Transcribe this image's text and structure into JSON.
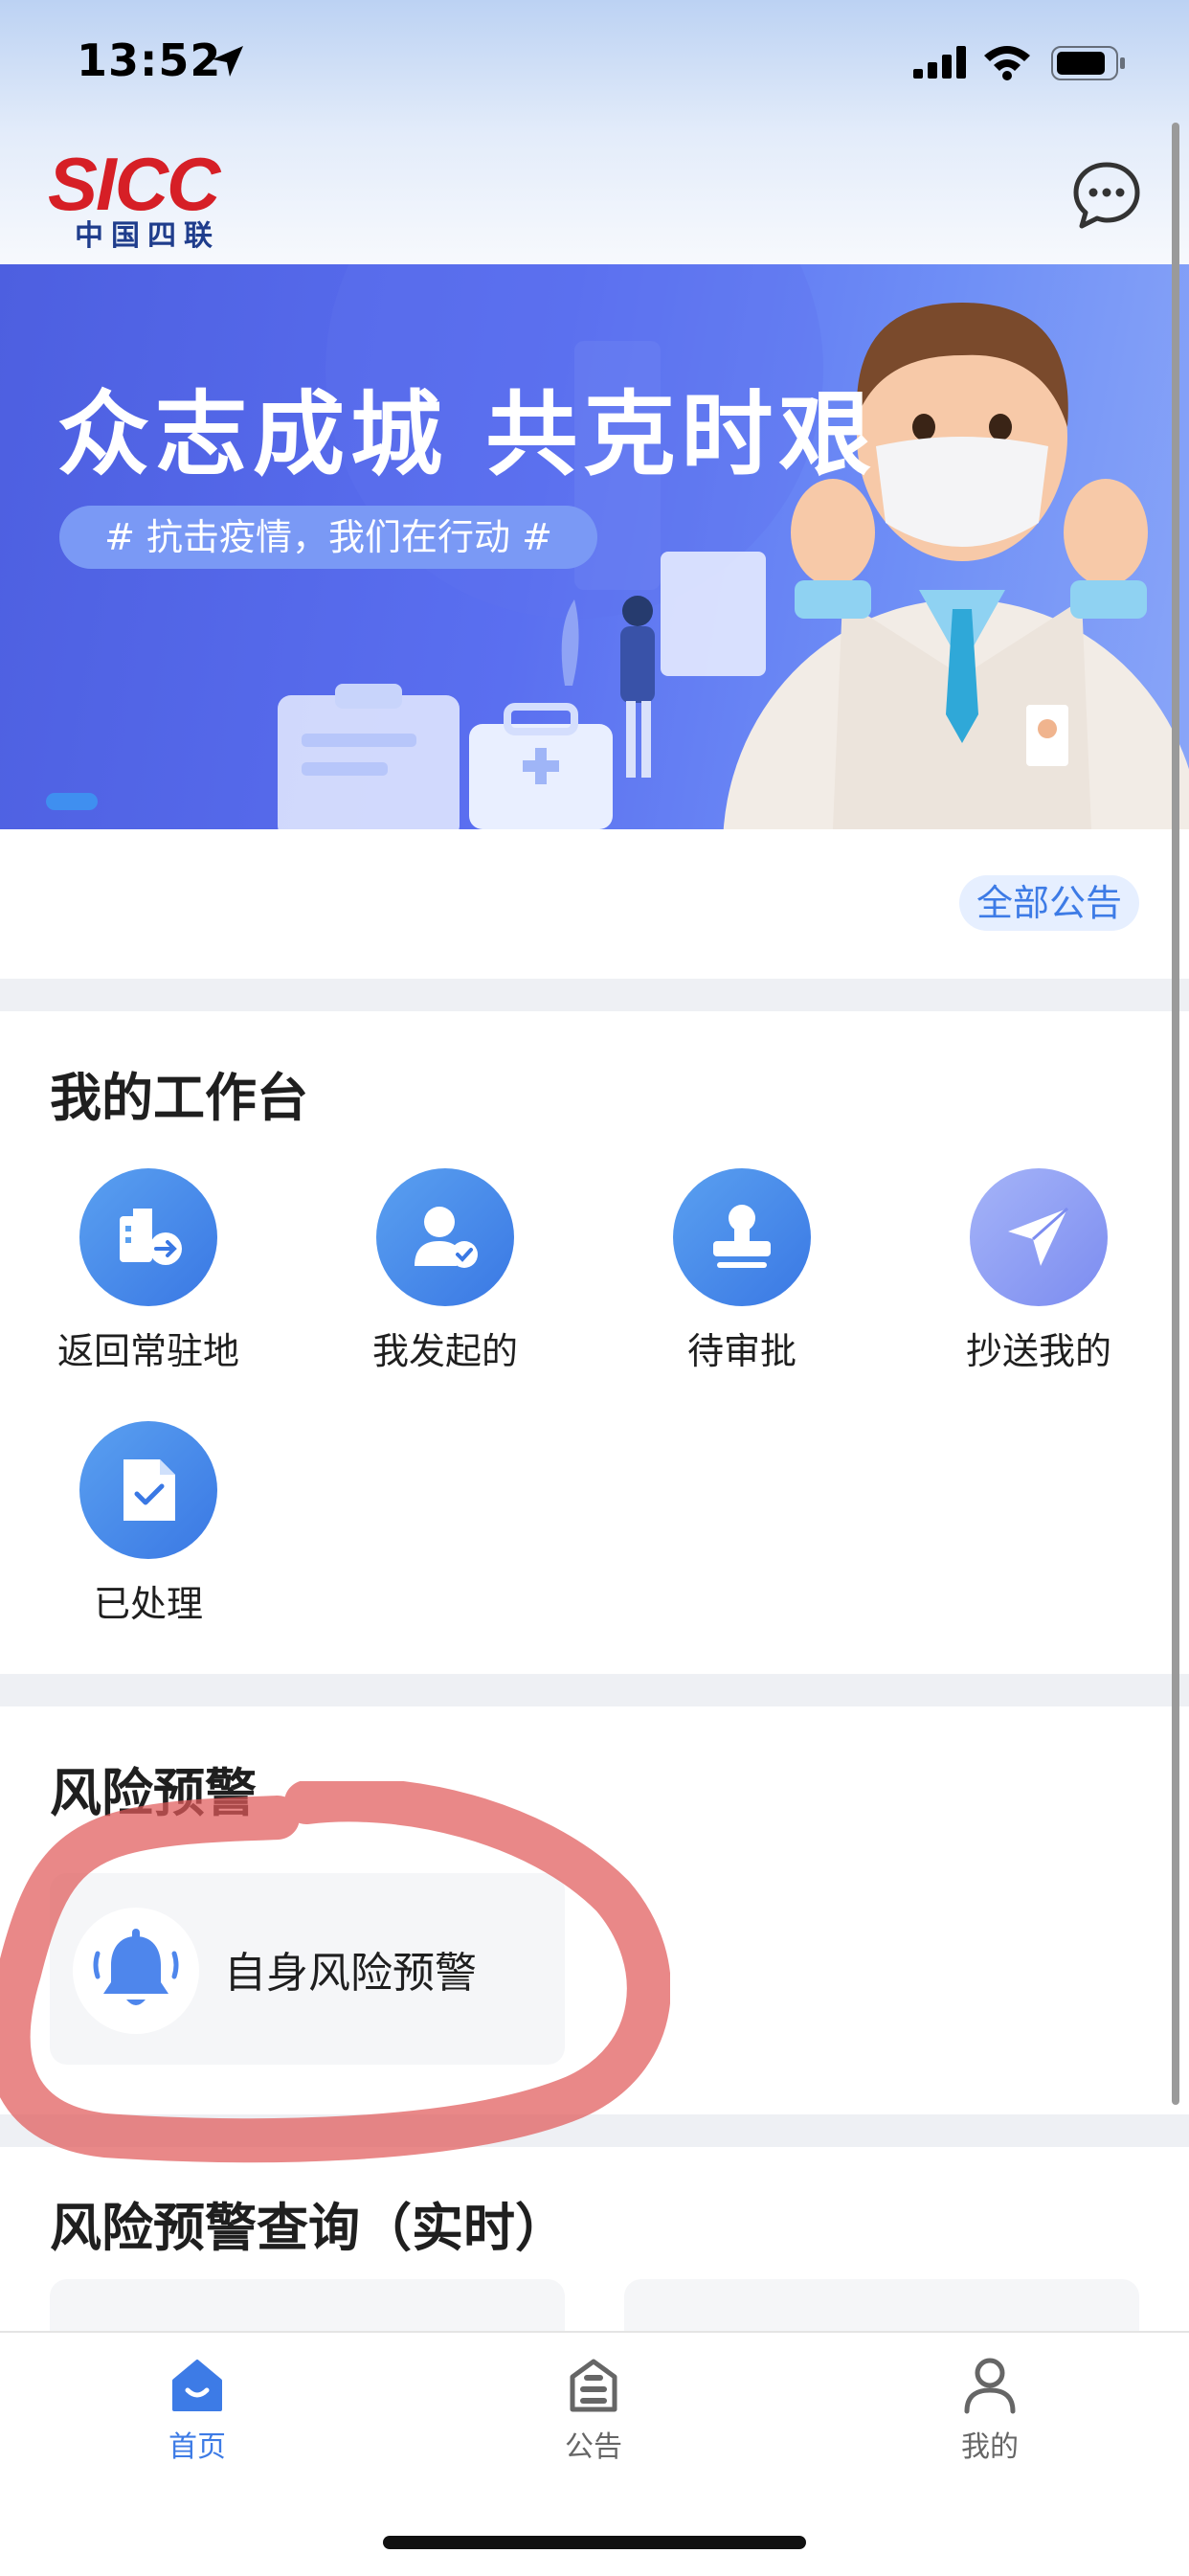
{
  "status_bar": {
    "time": "13:52"
  },
  "header": {
    "logo_text": "SICC",
    "logo_subtitle": "中国四联"
  },
  "banner": {
    "title": "众志成城  共克时艰",
    "tag": "# 抗击疫情，我们在行动 #"
  },
  "notice": {
    "all_label": "全部公告"
  },
  "workbench": {
    "title": "我的工作台",
    "items": [
      {
        "label": "返回常驻地",
        "icon": "building-return-icon"
      },
      {
        "label": "我发起的",
        "icon": "user-check-icon"
      },
      {
        "label": "待审批",
        "icon": "stamp-icon"
      },
      {
        "label": "抄送我的",
        "icon": "send-icon"
      },
      {
        "label": "已处理",
        "icon": "document-check-icon"
      }
    ]
  },
  "risk": {
    "title": "风险预警",
    "card_label": "自身风险预警"
  },
  "query": {
    "title": "风险预警查询（实时）"
  },
  "tabbar": {
    "items": [
      {
        "label": "首页",
        "active": true
      },
      {
        "label": "公告",
        "active": false
      },
      {
        "label": "我的",
        "active": false
      }
    ]
  },
  "colors": {
    "accent": "#3d7be6",
    "banner": "#5a6ff0",
    "brand_red": "#d61f26",
    "annotation": "#e86a6a"
  }
}
